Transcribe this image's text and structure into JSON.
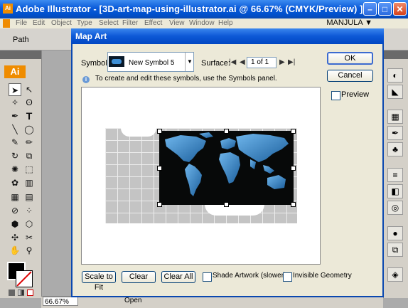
{
  "window": {
    "title": "Adobe Illustrator - [3D-art-map-using-illustrator.ai @ 66.67% (CMYK/Preview) ]"
  },
  "menubar": {
    "items": [
      "File",
      "Edit",
      "Object",
      "Type",
      "Select",
      "Filter",
      "Effect",
      "View",
      "Window",
      "Help"
    ],
    "user": "MANJULA ▼"
  },
  "control_bar": {
    "label": "Path"
  },
  "tools": {
    "logo": "Ai"
  },
  "status": {
    "zoom": "66.67%",
    "document": "Open"
  },
  "dialog": {
    "title": "Map Art",
    "symbol_label": "Symbol:",
    "symbol_value": "New Symbol 5",
    "surface_label": "Surface:",
    "surface_value": "1 of 1",
    "info": "To create and edit these symbols, use the Symbols panel.",
    "ok": "OK",
    "cancel": "Cancel",
    "preview": "Preview",
    "scale_to_fit": "Scale to Fit",
    "clear": "Clear",
    "clear_all": "Clear All",
    "shade_artwork": "Shade Artwork (slower)",
    "invisible_geometry": "Invisible Geometry"
  },
  "colors": {
    "titlebar": "#0a5ad9",
    "map_ocean": "#070909",
    "map_land": "#3e8fd6",
    "logo": "#ef8c00"
  }
}
